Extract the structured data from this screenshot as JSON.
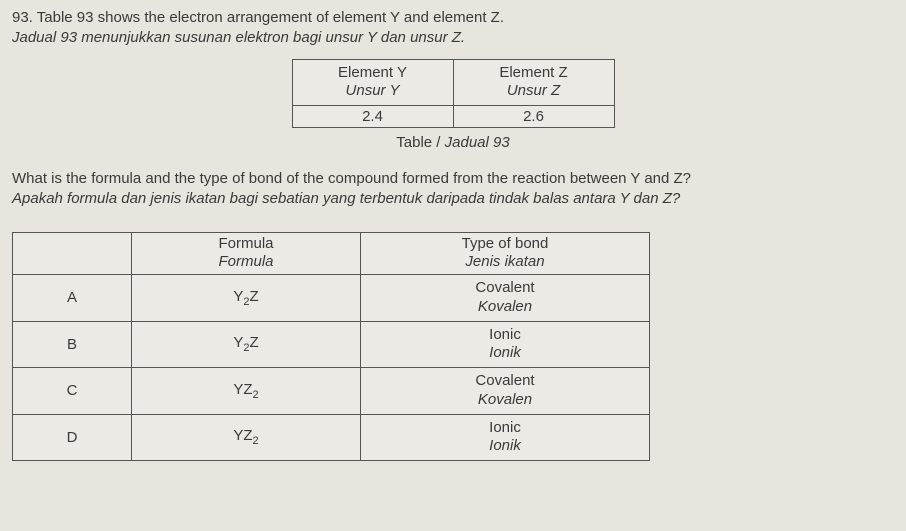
{
  "question": {
    "number": "93.",
    "text_en": "Table 93 shows the electron arrangement of element Y and element Z.",
    "text_ms": "Jadual 93 menunjukkan susunan elektron bagi unsur Y dan unsur Z."
  },
  "element_table": {
    "headers": {
      "y_en": "Element Y",
      "y_ms": "Unsur Y",
      "z_en": "Element Z",
      "z_ms": "Unsur Z"
    },
    "values": {
      "y": "2.4",
      "z": "2.6"
    },
    "caption_en": "Table",
    "caption_sep": " / ",
    "caption_ms": "Jadual 93"
  },
  "prompt": {
    "en": "What is the formula and the type of bond of the compound formed from the reaction between Y and Z?",
    "ms": "Apakah formula dan jenis ikatan bagi sebatian yang terbentuk daripada tindak balas antara Y dan Z?"
  },
  "answers": {
    "headers": {
      "formula_en": "Formula",
      "formula_ms": "Formula",
      "bond_en": "Type of bond",
      "bond_ms": "Jenis ikatan"
    },
    "rows": [
      {
        "label": "A",
        "formula_pre": "Y",
        "formula_sub": "2",
        "formula_post": "Z",
        "bond_en": "Covalent",
        "bond_ms": "Kovalen"
      },
      {
        "label": "B",
        "formula_pre": "Y",
        "formula_sub": "2",
        "formula_post": "Z",
        "bond_en": "Ionic",
        "bond_ms": "Ionik"
      },
      {
        "label": "C",
        "formula_pre": "YZ",
        "formula_sub": "2",
        "formula_post": "",
        "bond_en": "Covalent",
        "bond_ms": "Kovalen"
      },
      {
        "label": "D",
        "formula_pre": "YZ",
        "formula_sub": "2",
        "formula_post": "",
        "bond_en": "Ionic",
        "bond_ms": "Ionik"
      }
    ]
  }
}
